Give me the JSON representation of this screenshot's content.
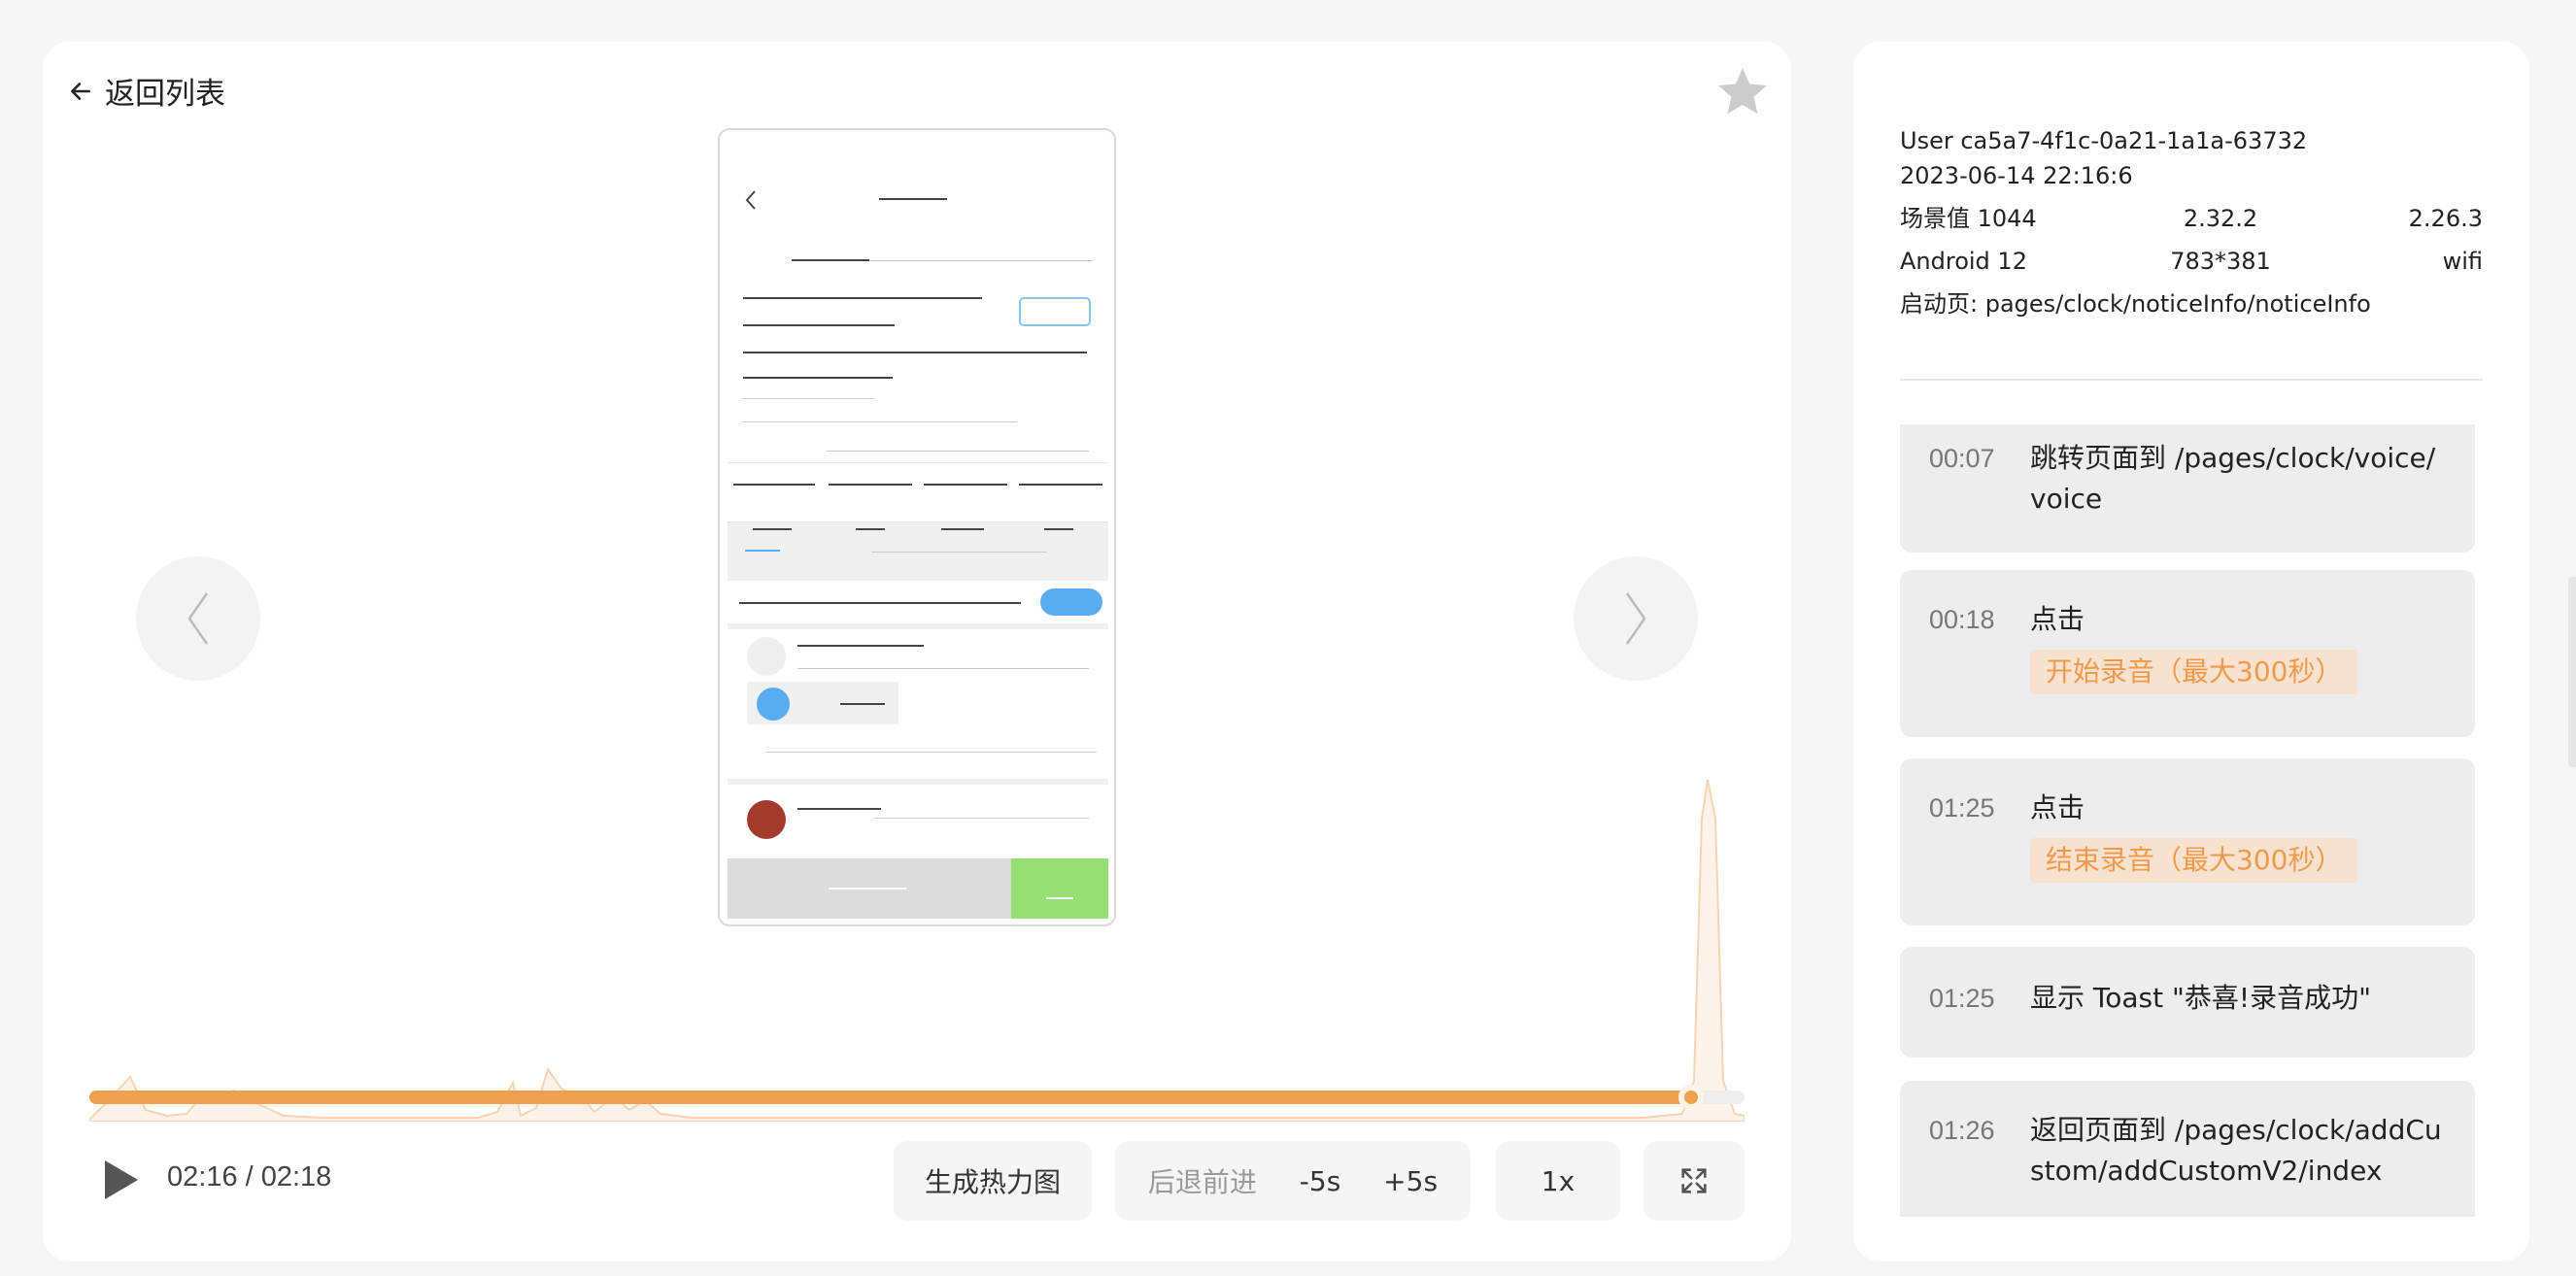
{
  "header": {
    "back_label": "返回列表"
  },
  "player": {
    "time_display": "02:16 / 02:18",
    "progress": 0.968,
    "heatmap_label": "生成热力图",
    "seek_label": "后退前进",
    "rewind_label": "-5s",
    "forward_label": "+5s",
    "speed_label": "1x"
  },
  "info": {
    "user": "User ca5a7-4f1c-0a21-1a1a-63732",
    "datetime": "2023-06-14 22:16:6",
    "scene": "场景值 1044",
    "version_a": "2.32.2",
    "version_b": "2.26.3",
    "os": "Android 12",
    "resolution": "783*381",
    "network": "wifi",
    "launch_page": "启动页: pages/clock/noticeInfo/noticeInfo"
  },
  "events": [
    {
      "time": "00:07",
      "text": "跳转页面到 /pages/clock/voice/voice"
    },
    {
      "time": "00:18",
      "text": "点击",
      "tag": "开始录音（最大300秒）"
    },
    {
      "time": "01:25",
      "text": "点击",
      "tag": "结束录音（最大300秒）"
    },
    {
      "time": "01:25",
      "text": "显示 Toast \"恭喜!录音成功\""
    },
    {
      "time": "01:26",
      "text": "返回页面到 /pages/clock/addCustom/addCustomV2/index"
    }
  ],
  "colors": {
    "accent": "#f0a14f",
    "tag_bg": "#f7e1cf",
    "tag_text": "#ef9a4a",
    "phone_blue": "#5aacf0",
    "phone_green": "#95df74"
  }
}
